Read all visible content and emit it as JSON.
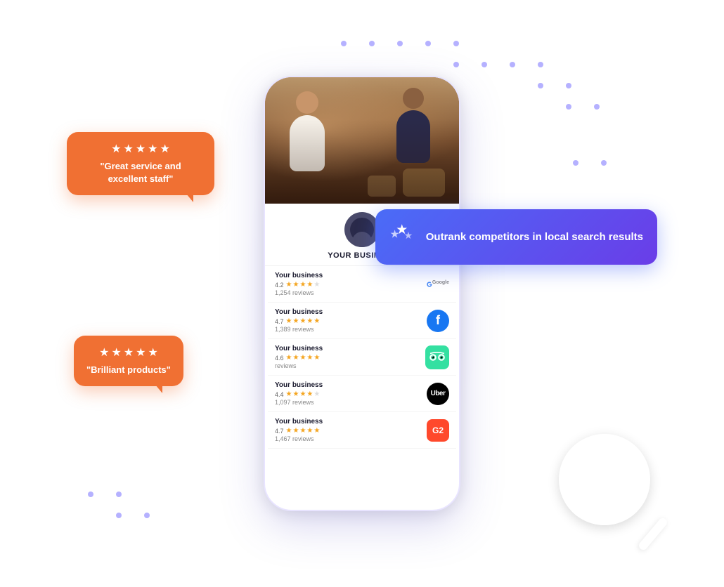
{
  "scene": {
    "phone": {
      "business_name": "YOUR BUSINESS",
      "reviews": [
        {
          "name": "Your business",
          "rating": "4.2",
          "stars": 4,
          "count": "1,254 reviews",
          "platform": "google"
        },
        {
          "name": "Your business",
          "rating": "4.7",
          "stars": 5,
          "count": "1,389 reviews",
          "platform": "facebook"
        },
        {
          "name": "Your business",
          "rating": "4.6",
          "stars": 5,
          "count": "reviews",
          "platform": "tripadvisor"
        },
        {
          "name": "Your business",
          "rating": "4.4",
          "stars": 4,
          "count": "1,097 reviews",
          "platform": "uber"
        },
        {
          "name": "Your business",
          "rating": "4.7",
          "stars": 5,
          "count": "1,467 reviews",
          "platform": "g2"
        }
      ]
    },
    "bubble_top": {
      "stars": 5,
      "text": "\"Great service and excellent staff\""
    },
    "bubble_bottom": {
      "stars": 5,
      "text": "\"Brilliant products\""
    },
    "outrank_bubble": {
      "text": "Outrank competitors in local search results"
    }
  }
}
